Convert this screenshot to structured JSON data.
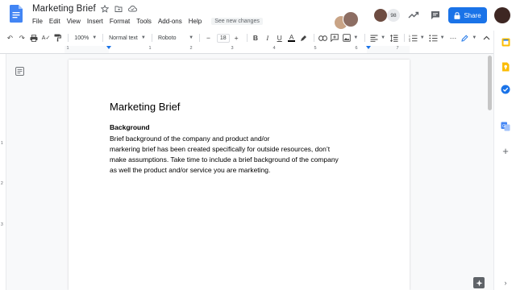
{
  "app": {
    "title": "Marketing Brief",
    "menu": [
      "File",
      "Edit",
      "View",
      "Insert",
      "Format",
      "Tools",
      "Add-ons",
      "Help"
    ],
    "see_new_changes": "See new changes",
    "viewer_count": "98",
    "share_label": "Share"
  },
  "toolbar": {
    "zoom": "100%",
    "style": "Normal text",
    "font": "Roboto",
    "font_size": "18",
    "minus": "−",
    "plus": "+",
    "bold": "B",
    "italic": "I",
    "underline": "U",
    "text_color_letter": "A"
  },
  "ruler": {
    "top_numbers": [
      "1",
      "1",
      "2",
      "3",
      "4",
      "5",
      "6",
      "7"
    ],
    "left_numbers": [
      "1",
      "2",
      "3"
    ]
  },
  "document": {
    "title": "Marketing Brief",
    "heading": "Background",
    "lines": [
      "Brief background of the company and product and/or",
      "markering brief has been created specifically for outside resources, don’t",
      "make assumptions. Take time to include a brief background of the company",
      "as well the product and/or service you are marketing."
    ]
  },
  "colors": {
    "accent": "#1a73e8",
    "docs_blue": "#4285f4"
  },
  "icons": {
    "header": [
      "docs-logo-icon",
      "star-icon",
      "move-to-folder-icon",
      "cloud-saved-icon",
      "activity-trend-icon",
      "comment-icon",
      "lock-icon"
    ],
    "side_panel": [
      "calendar-icon",
      "keep-icon",
      "tasks-icon",
      "translate-icon",
      "add-icon",
      "chevron-right-icon"
    ]
  }
}
